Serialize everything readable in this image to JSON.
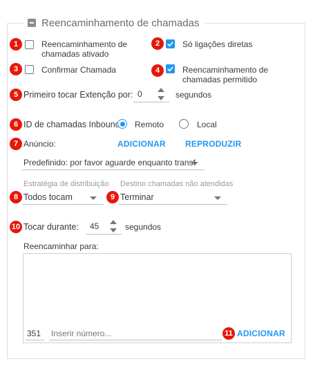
{
  "section": {
    "title": "Reencaminhamento de chamadas"
  },
  "badges": [
    "1",
    "2",
    "3",
    "4",
    "5",
    "6",
    "7",
    "8",
    "9",
    "10",
    "11"
  ],
  "options": {
    "forwarding_enabled": {
      "label_line1": "Reencaminhamento de",
      "label_line2": "chamadas ativado",
      "checked": false
    },
    "direct_calls_only": {
      "label": "Só ligações diretas",
      "checked": true
    },
    "confirm_call": {
      "label": "Confirmar Chamada",
      "checked": false
    },
    "forwarding_allowed": {
      "label_line1": "Reencaminhamento de",
      "label_line2": "chamadas permitido",
      "checked": true
    }
  },
  "first_ring": {
    "label": "Primeiro tocar Extenção por:",
    "value": "0",
    "unit": "segundos"
  },
  "inbound_caller_id": {
    "label": "ID de chamadas Inbound:",
    "options": [
      "Remoto",
      "Local"
    ],
    "selected": "Remoto"
  },
  "announcement": {
    "label": "Anúncio:",
    "add_label": "ADICIONAR",
    "play_label": "REPRODUZIR",
    "selected": "Predefinido: por favor aguarde enquanto transf"
  },
  "distribution": {
    "hint": "Estratégia de distribuição",
    "value": "Todos tocam"
  },
  "unanswered": {
    "hint": "Destino chamadas não atendidas",
    "value": "Terminar"
  },
  "ring_duration": {
    "label": "Tocar durante:",
    "value": "45",
    "unit": "segundos"
  },
  "forward_to": {
    "label": "Reencaminhar para:",
    "prefix_value": "351",
    "number_placeholder": "Inserir número...",
    "add_label": "ADICIONAR"
  },
  "colors": {
    "accent": "#2196f3",
    "badge": "#e6180a"
  }
}
